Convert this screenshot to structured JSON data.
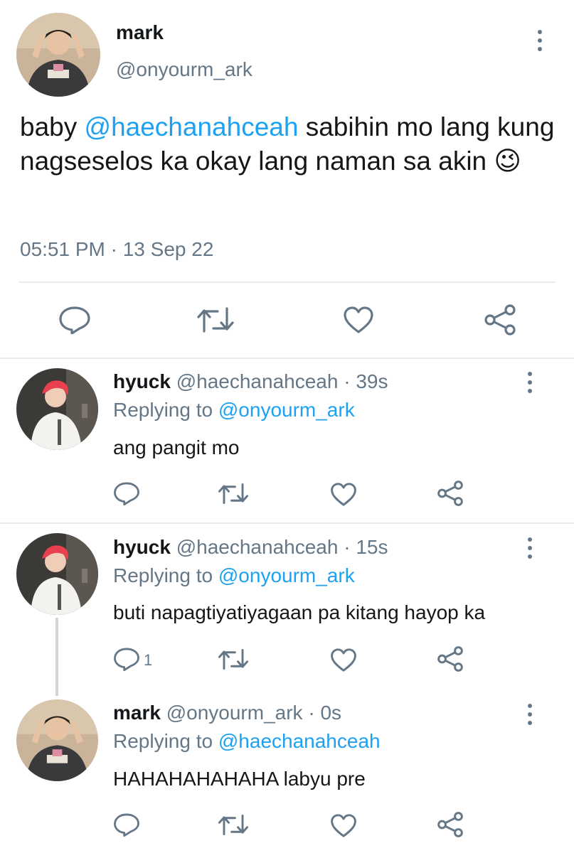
{
  "main_tweet": {
    "name": "mark",
    "handle": "@onyourm_ark",
    "text_before": "baby ",
    "mention": "@haechanahceah",
    "text_after": " sabihin mo lang kung nagseselos ka okay lang naman sa akin ",
    "emoji": "😉",
    "timestamp": "05:51 PM · 13 Sep 22",
    "actions": [
      "reply-icon",
      "retweet-icon",
      "like-icon",
      "share-icon"
    ]
  },
  "replies": [
    {
      "name": "hyuck",
      "handle": "@haechanahceah",
      "time": "· 39s",
      "replying_label": "Replying to ",
      "replying_to": "@onyourm_ark",
      "text": "ang pangit mo",
      "reply_count": ""
    },
    {
      "name": "hyuck",
      "handle": "@haechanahceah",
      "time": "· 15s",
      "replying_label": "Replying to ",
      "replying_to": "@onyourm_ark",
      "text": "buti napagtiyatiyagaan pa kitang hayop ka",
      "reply_count": "1"
    },
    {
      "name": "mark",
      "handle": "@onyourm_ark",
      "time": "· 0s",
      "replying_label": "Replying to ",
      "replying_to": "@haechanahceah",
      "text": "HAHAHAHAHAHA labyu pre",
      "reply_count": ""
    }
  ],
  "colors": {
    "accent": "#1da1f2",
    "secondary_text": "#657786",
    "divider": "#e6ecf0",
    "thread_line": "#ccd6dd"
  }
}
